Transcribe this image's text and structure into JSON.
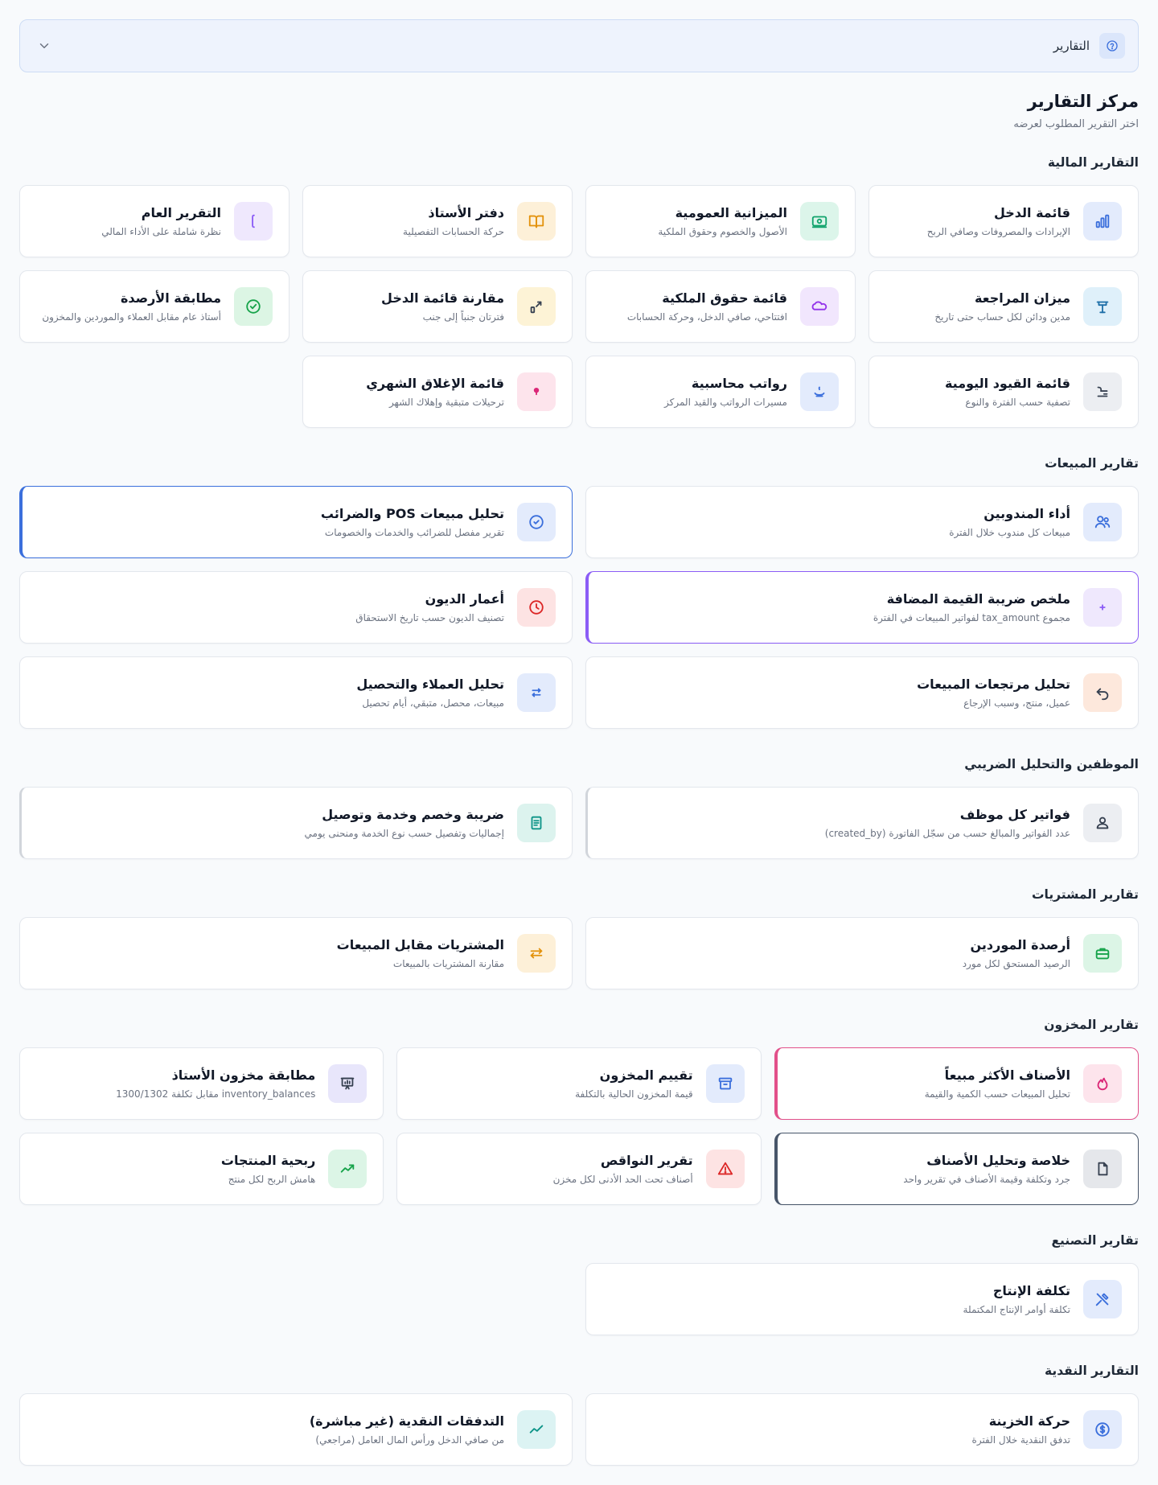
{
  "topbar": {
    "label": "التقارير",
    "icon": "help-circle-icon",
    "chevron": "chevron-down-icon"
  },
  "header": {
    "title": "مركز التقارير",
    "subtitle": "اختر التقرير المطلوب لعرضه"
  },
  "colors": {
    "accent": "#3b6fdc",
    "purple": "#8b5cf6",
    "pink": "#e2508a",
    "slate": "#475569"
  },
  "sections": {
    "financial": {
      "title": "التقارير المالية",
      "cards": [
        {
          "title": "قائمة الدخل",
          "desc": "الإيرادات والمصروفات وصافي الربح",
          "icon": "bar-chart-icon"
        },
        {
          "title": "الميزانية العمومية",
          "desc": "الأصول والخصوم وحقوق الملكية",
          "icon": "banknote-icon"
        },
        {
          "title": "دفتر الأستاذ",
          "desc": "حركة الحسابات التفصيلية",
          "icon": "book-open-icon"
        },
        {
          "title": "التقرير العام",
          "desc": "نظرة شاملة على الأداء المالي",
          "icon": "bracket-icon"
        },
        {
          "title": "ميزان المراجعة",
          "desc": "مدين ودائن لكل حساب حتى تاريخ",
          "icon": "scale-icon"
        },
        {
          "title": "قائمة حقوق الملكية",
          "desc": "افتتاحي، صافي الدخل، وحركة الحسابات",
          "icon": "cloud-icon"
        },
        {
          "title": "مقارنة قائمة الدخل",
          "desc": "فترتان جنباً إلى جنب",
          "icon": "compare-icon"
        },
        {
          "title": "مطابقة الأرصدة",
          "desc": "أستاذ عام مقابل العملاء والموردين والمخزون",
          "icon": "check-circle-icon"
        },
        {
          "title": "قائمة القيود اليومية",
          "desc": "تصفية حسب الفترة والنوع",
          "icon": "journal-icon"
        },
        {
          "title": "رواتب محاسبية",
          "desc": "مسيرات الرواتب والقيد المركز",
          "icon": "payroll-icon"
        },
        {
          "title": "قائمة الإغلاق الشهري",
          "desc": "ترحيلات متبقية وإهلاك الشهر",
          "icon": "pin-icon"
        }
      ]
    },
    "sales": {
      "title": "تقارير المبيعات",
      "cards": [
        {
          "title": "أداء المندوبين",
          "desc": "مبيعات كل مندوب خلال الفترة",
          "icon": "users-icon"
        },
        {
          "title": "تحليل مبيعات POS والضرائب",
          "desc": "تقرير مفصل للضرائب والخدمات والخصومات",
          "icon": "check-badge-icon"
        },
        {
          "title": "ملخص ضريبة القيمة المضافة",
          "desc": "مجموع tax_amount لفواتير المبيعات في الفترة",
          "icon": "plus-icon"
        },
        {
          "title": "أعمار الديون",
          "desc": "تصنيف الديون حسب تاريخ الاستحقاق",
          "icon": "clock-icon"
        },
        {
          "title": "تحليل مرتجعات المبيعات",
          "desc": "عميل، منتج، وسبب الإرجاع",
          "icon": "undo-icon"
        },
        {
          "title": "تحليل العملاء والتحصيل",
          "desc": "مبيعات، محصل، متبقي، أيام تحصيل",
          "icon": "transfer-icon"
        }
      ]
    },
    "employees": {
      "title": "الموظفين والتحليل الضريبي",
      "cards": [
        {
          "title": "فواتير كل موظف",
          "desc": "عدد الفواتير والمبالغ حسب من سجّل الفاتورة (created_by)",
          "icon": "user-icon"
        },
        {
          "title": "ضريبة وخصم وخدمة وتوصيل",
          "desc": "إجماليات وتفصيل حسب نوع الخدمة ومنحنى يومي",
          "icon": "receipt-icon"
        }
      ]
    },
    "purchases": {
      "title": "تقارير المشتريات",
      "cards": [
        {
          "title": "أرصدة الموردين",
          "desc": "الرصيد المستحق لكل مورد",
          "icon": "briefcase-icon"
        },
        {
          "title": "المشتريات مقابل المبيعات",
          "desc": "مقارنة المشتريات بالمبيعات",
          "icon": "swap-icon"
        }
      ]
    },
    "inventory": {
      "title": "تقارير المخزون",
      "cards": [
        {
          "title": "الأصناف الأكثر مبيعاً",
          "desc": "تحليل المبيعات حسب الكمية والقيمة",
          "icon": "flame-icon"
        },
        {
          "title": "تقييم المخزون",
          "desc": "قيمة المخزون الحالية بالتكلفة",
          "icon": "archive-icon"
        },
        {
          "title": "مطابقة مخزون الأستاذ",
          "desc": "inventory_balances مقابل تكلفة 1300/1302",
          "icon": "presentation-icon"
        },
        {
          "title": "خلاصة وتحليل الأصناف",
          "desc": "جرد وتكلفة وقيمة الأصناف في تقرير واحد",
          "icon": "file-icon"
        },
        {
          "title": "تقرير النواقص",
          "desc": "أصناف تحت الحد الأدنى لكل مخزن",
          "icon": "warning-icon"
        },
        {
          "title": "ربحية المنتجات",
          "desc": "هامش الربح لكل منتج",
          "icon": "trend-icon"
        }
      ]
    },
    "manufacturing": {
      "title": "تقارير التصنيع",
      "cards": [
        {
          "title": "تكلفة الإنتاج",
          "desc": "تكلفة أوامر الإنتاج المكتملة",
          "icon": "tools-icon"
        }
      ]
    },
    "cash": {
      "title": "التقارير النقدية",
      "cards": [
        {
          "title": "حركة الخزينة",
          "desc": "تدفق النقدية خلال الفترة",
          "icon": "dollar-circle-icon"
        },
        {
          "title": "التدفقات النقدية (غير مباشرة)",
          "desc": "من صافي الدخل ورأس المال العامل (مراجعي)",
          "icon": "trend-icon"
        }
      ]
    }
  }
}
